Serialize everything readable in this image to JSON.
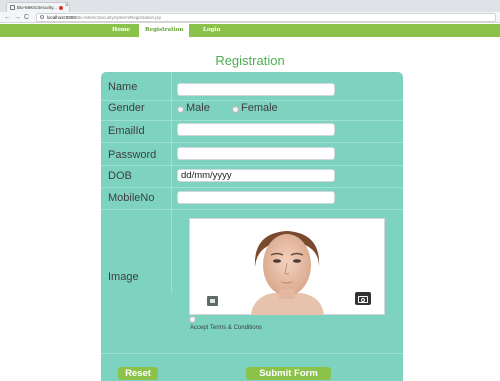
{
  "browser": {
    "tab_title": "Bio-MetricSecurity...",
    "url_host": "localhost:8080",
    "url_path": "/Bio-MetricSecuritySystem/Registration.jsp"
  },
  "nav": {
    "home": "Home",
    "registration": "Registration",
    "login": "Login"
  },
  "form": {
    "title": "Registration",
    "labels": {
      "name": "Name",
      "gender": "Gender",
      "email": "EmailId",
      "password": "Password",
      "dob": "DOB",
      "mobile": "MobileNo",
      "image": "Image"
    },
    "gender_options": [
      "Male",
      "Female"
    ],
    "dob_value": "dd/mm/yyyy",
    "terms_label": "Accept Terms & Conditions",
    "reset_label": "Reset",
    "submit_label": "Submit Form"
  },
  "colors": {
    "accent": "#8bc34a",
    "panel": "#7dd3bf",
    "title": "#4caf50"
  }
}
